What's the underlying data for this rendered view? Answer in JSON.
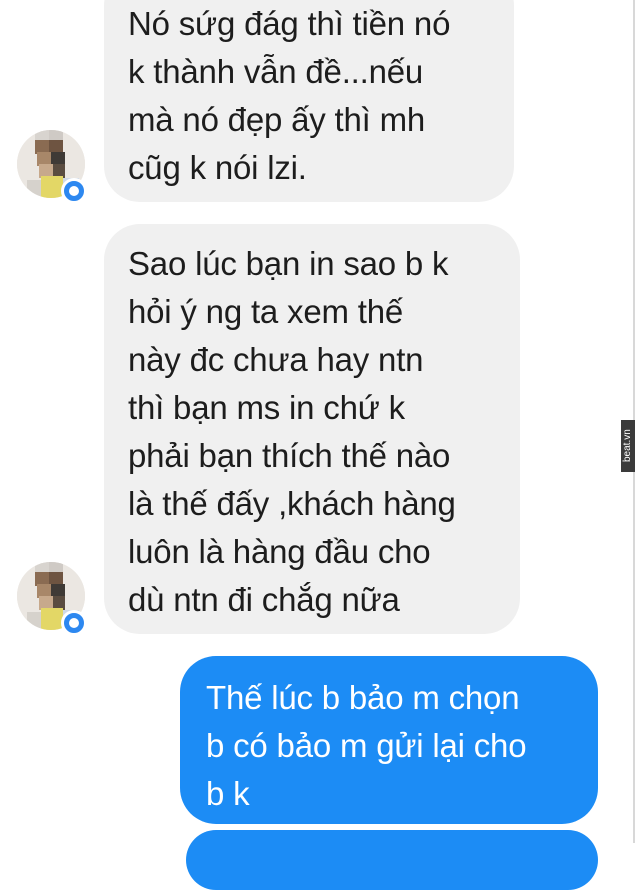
{
  "messages": [
    {
      "direction": "incoming",
      "lines": [
        "Nó sứg đág thì tiền nó",
        "k thành vẫn đề...nếu",
        "mà nó đẹp ấy thì mh",
        "cũg k nói lzi."
      ]
    },
    {
      "direction": "incoming",
      "lines": [
        "Sao lúc bạn in sao b k",
        "hỏi ý ng ta xem thế",
        "này đc chưa hay ntn",
        "thì bạn ms in chứ k",
        "phải bạn thích thế nào",
        "là thế đấy ,khách hàng",
        "luôn là hàng đầu cho",
        "dù ntn đi chắg nữa"
      ]
    },
    {
      "direction": "outgoing",
      "lines": [
        "Thế lúc b bảo m chọn",
        "b có bảo m gửi lại cho",
        "b k"
      ]
    },
    {
      "direction": "outgoing",
      "lines": []
    }
  ],
  "watermark": "beat.vn",
  "colors": {
    "incoming_bubble": "#f0f0f0",
    "outgoing_bubble": "#1c8cf5",
    "incoming_text": "#1d1d1d",
    "outgoing_text": "#ffffff"
  },
  "icons": {
    "avatar": "blurred-profile-photo",
    "badge": "messenger-badge-icon"
  }
}
